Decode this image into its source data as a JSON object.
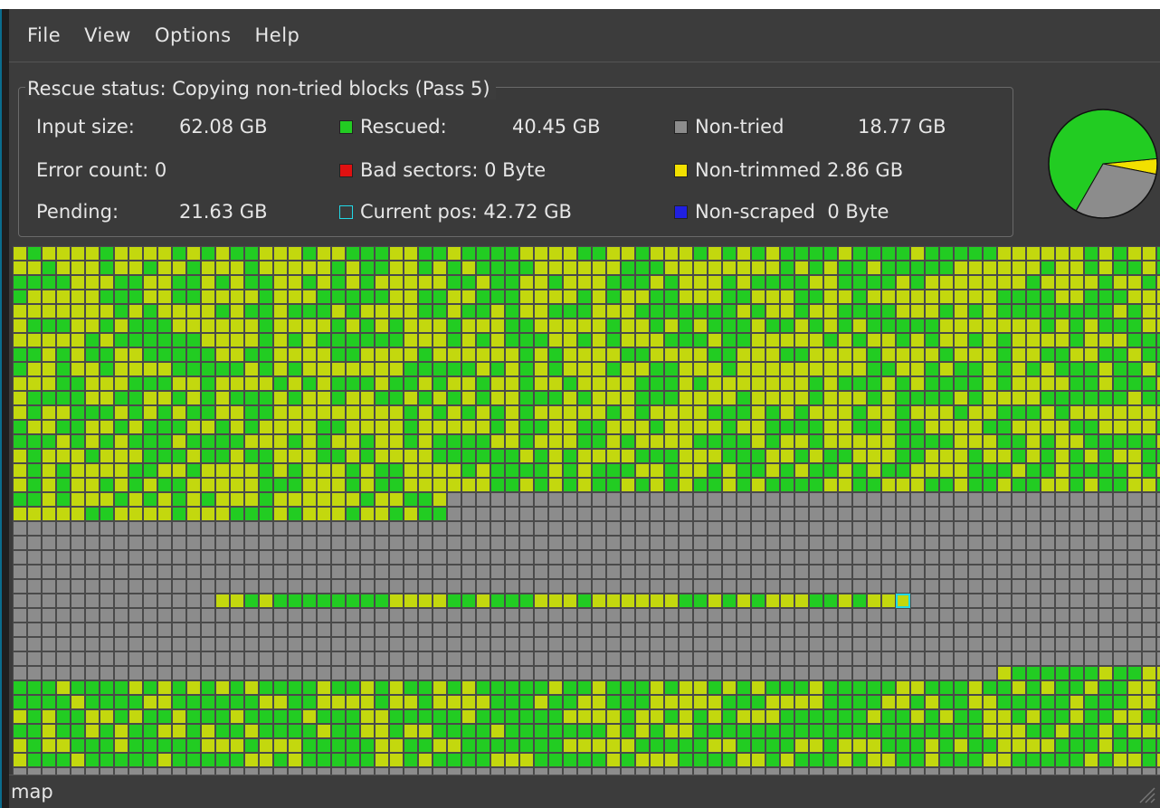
{
  "menu": {
    "items": [
      "File",
      "View",
      "Options",
      "Help"
    ]
  },
  "status": {
    "title": "Rescue status:  Copying non-tried blocks (Pass 5)",
    "input_size_label": "Input size:",
    "input_size_value": "62.08 GB",
    "error_count_label": "Error count: 0",
    "pending_label": "Pending:",
    "pending_value": "21.63 GB",
    "rescued_label": "Rescued:",
    "rescued_value": "40.45 GB",
    "bad_sectors_label": "Bad sectors: 0 Byte",
    "current_pos_label": "Current pos: 42.72 GB",
    "non_tried_label": "Non-tried",
    "non_tried_value": "18.77 GB",
    "non_trimmed_label": "Non-trimmed 2.86 GB",
    "non_scraped_label": "Non-scraped  0 Byte"
  },
  "colors": {
    "rescued": "#22cc22",
    "non_trimmed": "#c3d80e",
    "non_tried": "#8c8c8c",
    "bad": "#e01010",
    "current": "#22d8e6",
    "non_scraped": "#2020e0",
    "yellow": "#f2e000"
  },
  "icons": {
    "rescued": "green-square-icon",
    "bad_sectors": "red-square-icon",
    "current_pos": "cyan-outline-square-icon",
    "non_tried": "gray-square-icon",
    "non_trimmed": "yellow-square-icon",
    "non_scraped": "blue-square-icon",
    "resize_grip": "resize-grip-icon"
  },
  "pie_fractions": {
    "rescued": 0.652,
    "non_tried": 0.302,
    "non_trimmed": 0.046
  },
  "map": {
    "current_position_fraction": 0.688
  },
  "statusbar": {
    "text": "map"
  }
}
